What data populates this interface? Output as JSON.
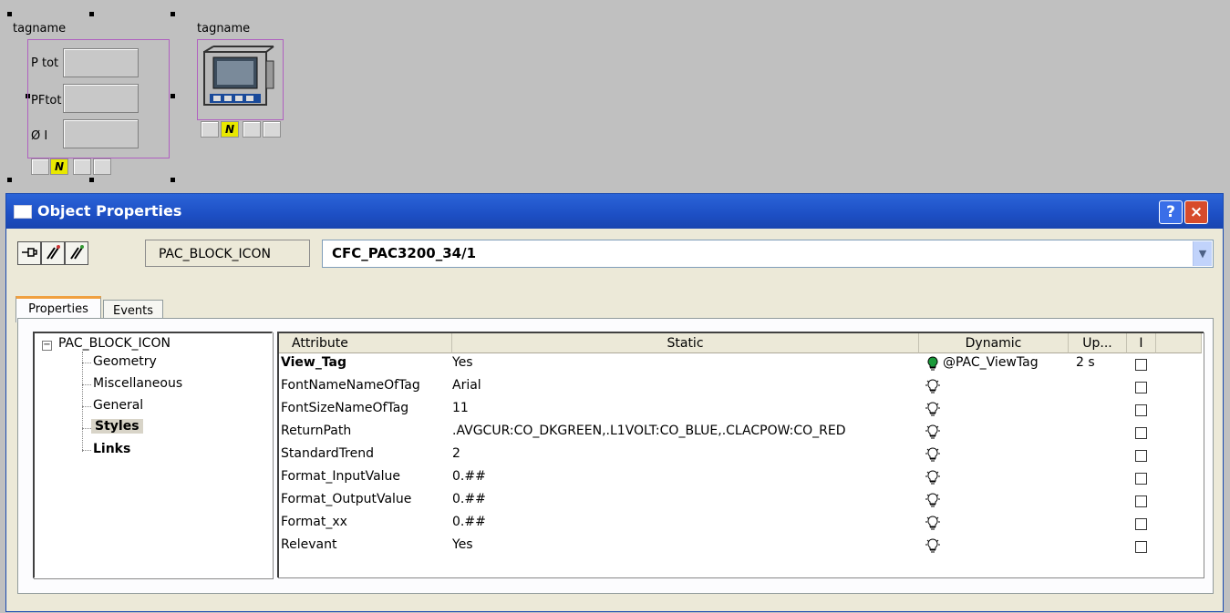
{
  "canvas": {
    "faceplate1": {
      "tagname": "tagname",
      "labels": [
        "P tot",
        "PFtot",
        "Ø I"
      ],
      "status_button": "N"
    },
    "faceplate2": {
      "tagname": "tagname",
      "status_button": "N"
    }
  },
  "dialog": {
    "title": "Object Properties",
    "help_button": "?",
    "close_button": "×",
    "object_type": "PAC_BLOCK_ICON",
    "object_name": "CFC_PAC3200_34/1",
    "tabs": [
      "Properties",
      "Events"
    ],
    "tree": {
      "root": "PAC_BLOCK_ICON",
      "children": [
        "Geometry",
        "Miscellaneous",
        "General",
        "Styles",
        "Links"
      ]
    },
    "grid": {
      "columns": [
        "Attribute",
        "Static",
        "Dynamic",
        "Up...",
        "I"
      ],
      "rows": [
        {
          "attribute": "View_Tag",
          "static": "Yes",
          "dynamic": "@PAC_ViewTag",
          "update": "2 s",
          "dynamic_active": true
        },
        {
          "attribute": "FontNameNameOfTag",
          "static": "Arial",
          "dynamic": "",
          "update": ""
        },
        {
          "attribute": "FontSizeNameOfTag",
          "static": "11",
          "dynamic": "",
          "update": ""
        },
        {
          "attribute": "ReturnPath",
          "static": ".AVGCUR:CO_DKGREEN,.L1VOLT:CO_BLUE,.CLACPOW:CO_RED",
          "dynamic": "",
          "update": ""
        },
        {
          "attribute": "StandardTrend",
          "static": "2",
          "dynamic": "",
          "update": ""
        },
        {
          "attribute": "Format_InputValue",
          "static": "0.##",
          "dynamic": "",
          "update": ""
        },
        {
          "attribute": "Format_OutputValue",
          "static": "0.##",
          "dynamic": "",
          "update": ""
        },
        {
          "attribute": "Format_xx",
          "static": "0.##",
          "dynamic": "",
          "update": ""
        },
        {
          "attribute": "Relevant",
          "static": "Yes",
          "dynamic": "",
          "update": ""
        }
      ]
    }
  },
  "colors": {
    "titlebar": "#1d4fc4",
    "selection_frame": "#b060c0",
    "status_yellow": "#e8e800",
    "bulb_active": "#1a9a3a"
  }
}
